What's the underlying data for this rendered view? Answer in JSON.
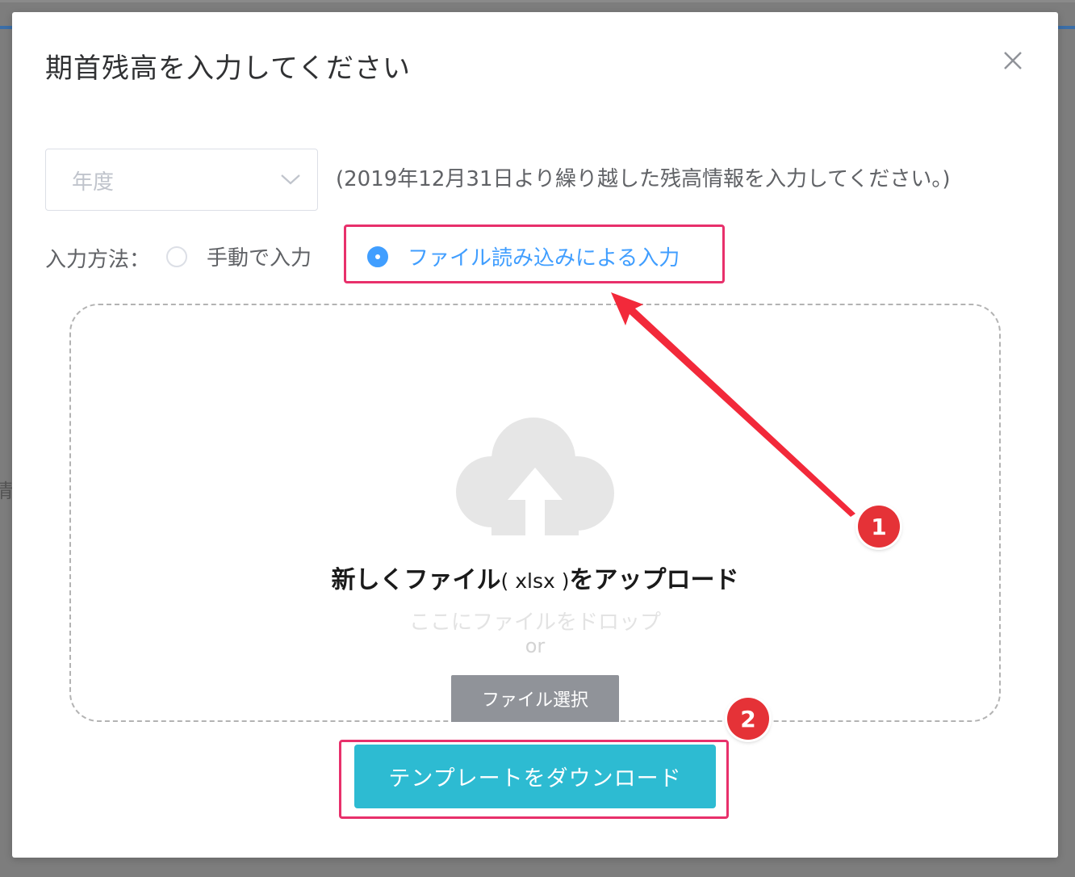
{
  "dialog": {
    "title": "期首残高を入力してください"
  },
  "year_select": {
    "placeholder": "年度",
    "note": "(2019年12月31日より繰り越した残高情報を入力してください。)"
  },
  "input_method": {
    "label": "入力方法：",
    "options": [
      {
        "label": "手動で入力",
        "selected": false
      },
      {
        "label": "ファイル読み込みによる入力",
        "selected": true
      }
    ]
  },
  "upload": {
    "title_before": "新しくファイル",
    "title_ext": "( xlsx )",
    "title_after": "をアップロード",
    "drop_hint": "ここにファイルをドロップ",
    "or": "or",
    "select_button": "ファイル選択"
  },
  "download_button": "テンプレートをダウンロード",
  "annotations": {
    "badge_1": "1",
    "badge_2": "2",
    "highlight_color": "#e8306b",
    "badge_color": "#e53237"
  },
  "backdrop": {
    "partial_char": "情"
  },
  "colors": {
    "accent": "#409eff",
    "download_button": "#2dbbd2",
    "select_button": "#909399"
  },
  "icons": {
    "close": "close-icon",
    "chevron": "chevron-down-icon",
    "upload": "cloud-upload-icon"
  }
}
